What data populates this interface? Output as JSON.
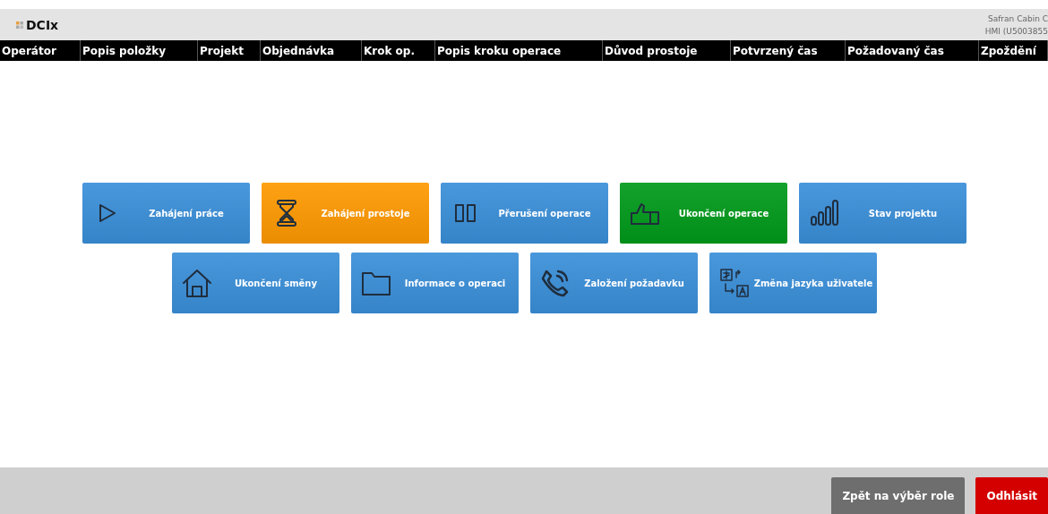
{
  "header": {
    "logo": "DCIx",
    "info_lines": [
      "Safran Cabin C",
      "HMI (U5003855"
    ]
  },
  "columns": [
    "Operátor",
    "Popis položky",
    "Projekt",
    "Objednávka",
    "Krok op.",
    "Popis kroku operace",
    "Důvod prostoje",
    "Potvrzený čas",
    "Požadovaný čas",
    "Zpoždění"
  ],
  "tile_rows": [
    [
      {
        "label": "Zahájení práce",
        "kind": "play",
        "color": "#3a8fd9"
      },
      {
        "label": "Zahájení prostoje",
        "kind": "hourglass",
        "color": "#ff9900"
      },
      {
        "label": "Přerušení operace",
        "kind": "pause",
        "color": "#3a8fd9"
      },
      {
        "label": "Ukončení operace",
        "kind": "thumb",
        "color": "#009a1a"
      },
      {
        "label": "Stav projektu",
        "kind": "bars",
        "color": "#3a8fd9"
      }
    ],
    [
      {
        "label": "Ukončení směny",
        "kind": "home",
        "color": "#3a8fd9"
      },
      {
        "label": "Informace o operaci",
        "kind": "folder",
        "color": "#3a8fd9"
      },
      {
        "label": "Založení požadavku",
        "kind": "phone",
        "color": "#3a8fd9"
      },
      {
        "label": "Změna jazyka uživatele",
        "kind": "translate",
        "color": "#3a8fd9"
      }
    ]
  ],
  "footer_buttons": [
    {
      "label": "Zpět na výběr role",
      "color": "#6e6e6e"
    },
    {
      "label": "Odhlásit",
      "color": "#d40000"
    }
  ]
}
